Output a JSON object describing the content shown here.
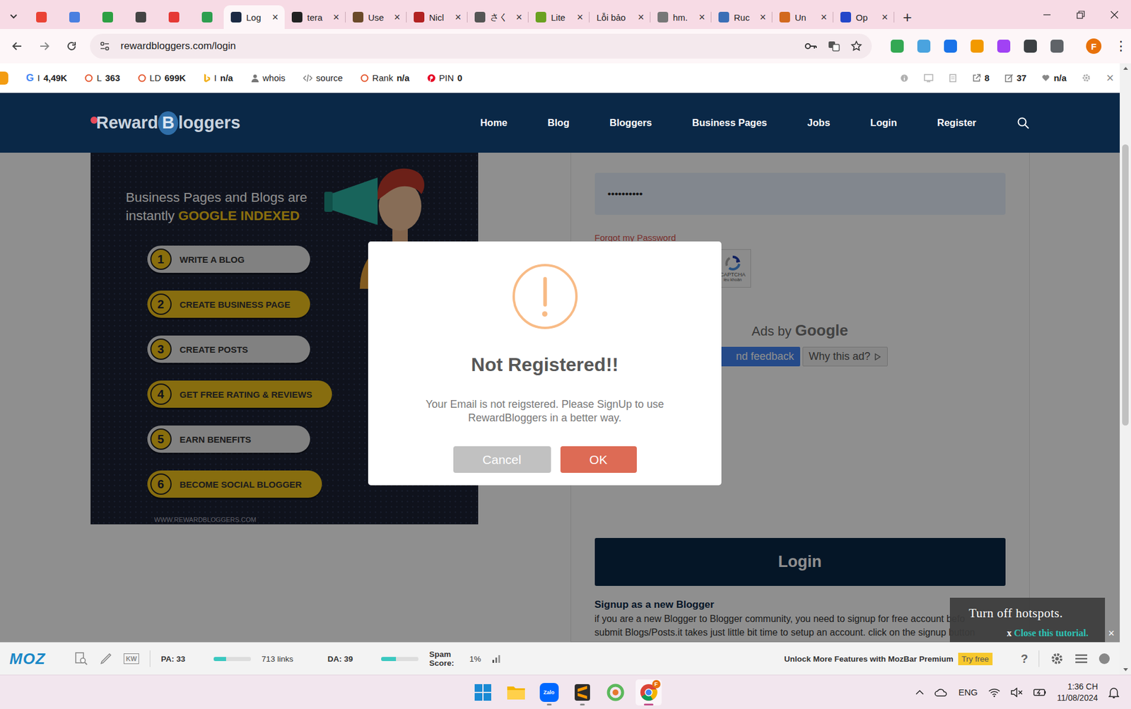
{
  "window": {
    "title": "RewardBloggers login"
  },
  "tabstrip": {
    "pinned": [
      {
        "selected": false
      },
      {
        "selected": false
      },
      {
        "selected": false
      },
      {
        "selected": false
      },
      {
        "selected": false
      },
      {
        "selected": false
      }
    ],
    "tabs": [
      {
        "label": "Log",
        "selected": true
      },
      {
        "label": "tera",
        "selected": false
      },
      {
        "label": "Use",
        "selected": false
      },
      {
        "label": "Nicl",
        "selected": false
      },
      {
        "label": "さく",
        "selected": false
      },
      {
        "label": "Lite",
        "selected": false
      },
      {
        "label": "Lỗi bảo",
        "selected": false
      },
      {
        "label": "hm.",
        "selected": false
      },
      {
        "label": "Ruc",
        "selected": false
      },
      {
        "label": "Un",
        "selected": false
      },
      {
        "label": "Op",
        "selected": false
      }
    ],
    "close": "×",
    "new_tab": "+"
  },
  "toolbar": {
    "url": "rewardbloggers.com/login",
    "profile": "F",
    "menu": "⋮"
  },
  "seo_bar": {
    "google_mark": "G",
    "items": [
      {
        "label": "I",
        "value": "4,49K"
      },
      {
        "label": "L",
        "value": "363"
      },
      {
        "label": "LD",
        "value": "699K"
      },
      {
        "label": "I",
        "value": "n/a"
      },
      {
        "label": "whois",
        "value": ""
      },
      {
        "label": "source",
        "value": ""
      },
      {
        "label": "Rank",
        "value": "n/a"
      },
      {
        "label": "PIN",
        "value": "0"
      }
    ],
    "right": [
      {
        "value": "8"
      },
      {
        "value": "37"
      },
      {
        "value": "n/a"
      }
    ],
    "close": "×"
  },
  "site": {
    "logo": {
      "first": "Reward",
      "mark": "B",
      "rest": "loggers"
    },
    "nav": [
      {
        "label": "Home",
        "selected": false
      },
      {
        "label": "Blog",
        "selected": false
      },
      {
        "label": "Bloggers",
        "selected": false
      },
      {
        "label": "Business Pages",
        "selected": false
      },
      {
        "label": "Jobs",
        "selected": false
      },
      {
        "label": "Login",
        "selected": false
      },
      {
        "label": "Register",
        "selected": false
      }
    ]
  },
  "promo": {
    "headline_1": "Business Pages and Blogs are",
    "headline_2a": "instantly",
    "headline_2b": "GOOGLE INDEXED",
    "steps": [
      {
        "number": "1",
        "label": "WRITE A BLOG",
        "color": "#e6e6e6"
      },
      {
        "number": "2",
        "label": "CREATE BUSINESS PAGE",
        "color": "#f1c21b"
      },
      {
        "number": "3",
        "label": "CREATE POSTS",
        "color": "#e6e6e6"
      },
      {
        "number": "4",
        "label": "GET FREE RATING & REVIEWS",
        "color": "#f1c21b"
      },
      {
        "number": "5",
        "label": "EARN BENEFITS",
        "color": "#e6e6e6"
      },
      {
        "number": "6",
        "label": "BECOME SOCIAL BLOGGER",
        "color": "#f1c21b"
      }
    ],
    "footer": "WWW.REWARDBLOGGERS.COM"
  },
  "login_form": {
    "password": "••••••••••",
    "forgot": "Forgot my Password",
    "captcha": "CAPTCHA",
    "captcha_terms": "iều khoản",
    "ads": {
      "prefix": "Ads by",
      "brand": "Google",
      "feedback": "nd feedback",
      "why": "Why this ad?"
    },
    "login": "Login",
    "signup_title": "Signup as a new Blogger",
    "signup_line_1": "if you are a new Blogger to Blogger community, you need to signup for free account befo",
    "signup_line_2": "submit Blogs/Posts.it takes just little bit time to setup an account. click on the signup button"
  },
  "dialog": {
    "title": "Not Registered!!",
    "message": "Your Email is not reigstered. Please SignUp to use RewardBloggers in a better way.",
    "buttons": [
      {
        "label": "Cancel",
        "kind": "cancel"
      },
      {
        "label": "OK",
        "kind": "confirm"
      }
    ]
  },
  "tutorial": {
    "title": "Turn off hotspots.",
    "close_mark": "x",
    "close_label": "Close this tutorial.",
    "dismiss": "×"
  },
  "mozbar": {
    "logo": "MOZ",
    "kw": "KW",
    "pa": {
      "label": "PA: 33",
      "level": 0.33
    },
    "links": "713 links",
    "da": {
      "label": "DA: 39",
      "level": 0.39
    },
    "spam_label": "Spam Score:",
    "spam": "1%",
    "promo": "Unlock More Features with MozBar Premium",
    "try": "Try free",
    "help": "?"
  },
  "taskbar": {
    "zalo": "Zalo",
    "chrome_badge": "F",
    "lang": "ENG",
    "time": "1:36 CH",
    "date": "11/08/2024"
  }
}
